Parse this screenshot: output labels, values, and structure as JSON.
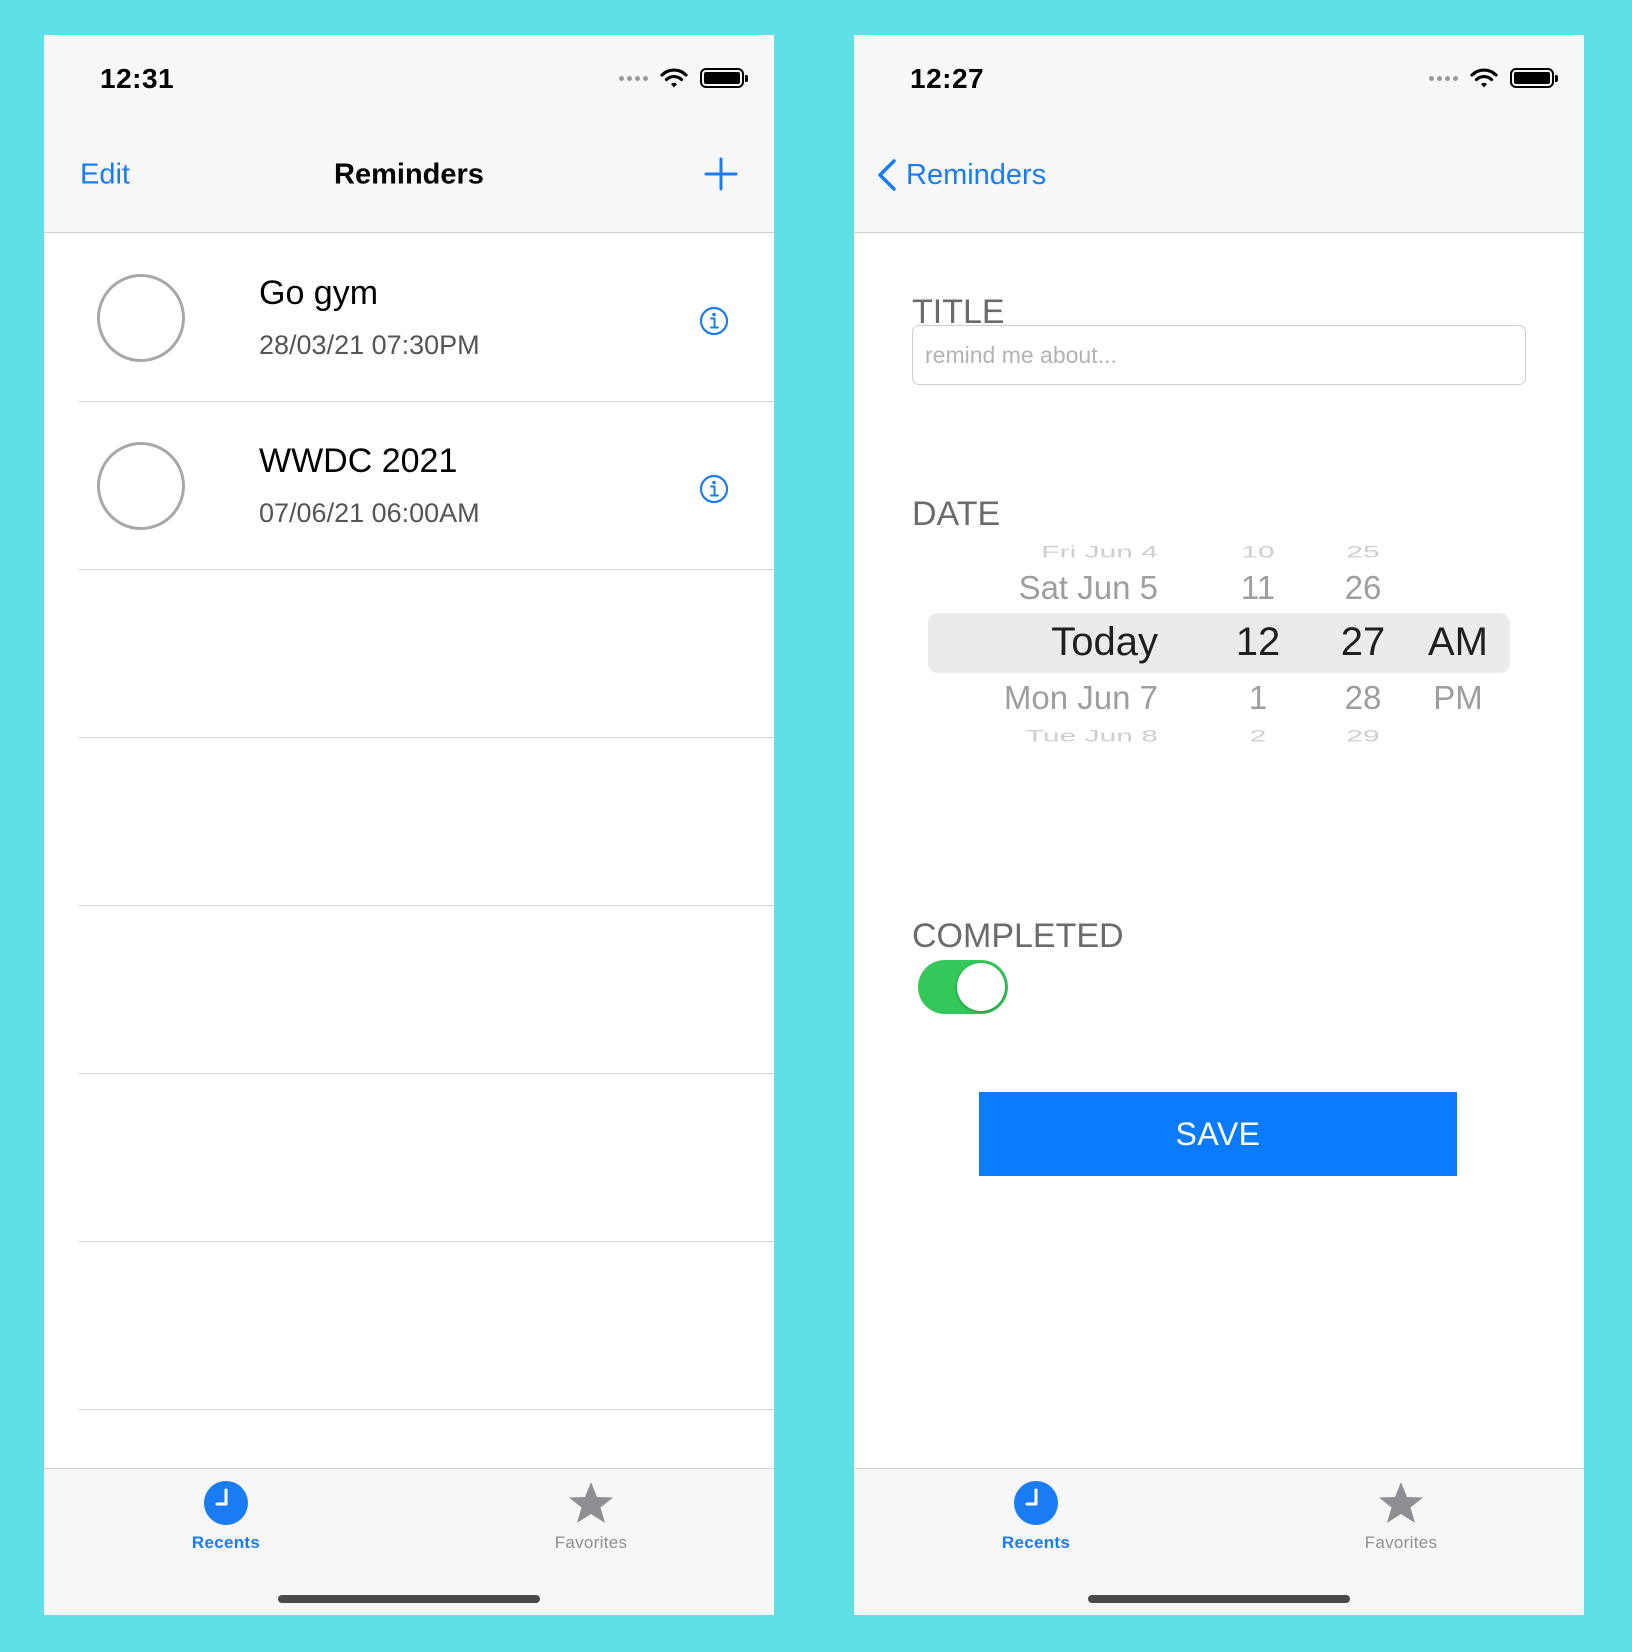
{
  "left_screen": {
    "status": {
      "time": "12:31"
    },
    "navbar": {
      "edit_label": "Edit",
      "title": "Reminders",
      "add_icon": "plus-icon"
    },
    "reminders": [
      {
        "title": "Go gym",
        "datetime": "28/03/21 07:30PM",
        "completed": false
      },
      {
        "title": "WWDC 2021",
        "datetime": "07/06/21 06:00AM",
        "completed": false
      }
    ],
    "tabbar": {
      "recents_label": "Recents",
      "favorites_label": "Favorites",
      "selected": "Recents"
    }
  },
  "right_screen": {
    "status": {
      "time": "12:27"
    },
    "navbar": {
      "back_label": "Reminders",
      "back_icon": "chevron-left-icon"
    },
    "form": {
      "title_label": "TITLE",
      "title_placeholder": "remind me about...",
      "title_value": "",
      "date_label": "DATE",
      "completed_label": "COMPLETED",
      "completed": true,
      "save_label": "SAVE"
    },
    "picker": {
      "rows": [
        {
          "date": "Fri Jun 4",
          "hour": "10",
          "minute": "25",
          "ampm": ""
        },
        {
          "date": "Sat Jun 5",
          "hour": "11",
          "minute": "26",
          "ampm": ""
        },
        {
          "date": "Today",
          "hour": "12",
          "minute": "27",
          "ampm": "AM"
        },
        {
          "date": "Mon Jun 7",
          "hour": "1",
          "minute": "28",
          "ampm": "PM"
        },
        {
          "date": "Tue Jun 8",
          "hour": "2",
          "minute": "29",
          "ampm": ""
        }
      ],
      "selected_index": 2
    },
    "tabbar": {
      "recents_label": "Recents",
      "favorites_label": "Favorites",
      "selected": "Recents"
    }
  },
  "colors": {
    "background": "#5ee0e6",
    "accent": "#1a7cf2",
    "toggle_on": "#34c759",
    "save_button": "#0a7bff"
  }
}
